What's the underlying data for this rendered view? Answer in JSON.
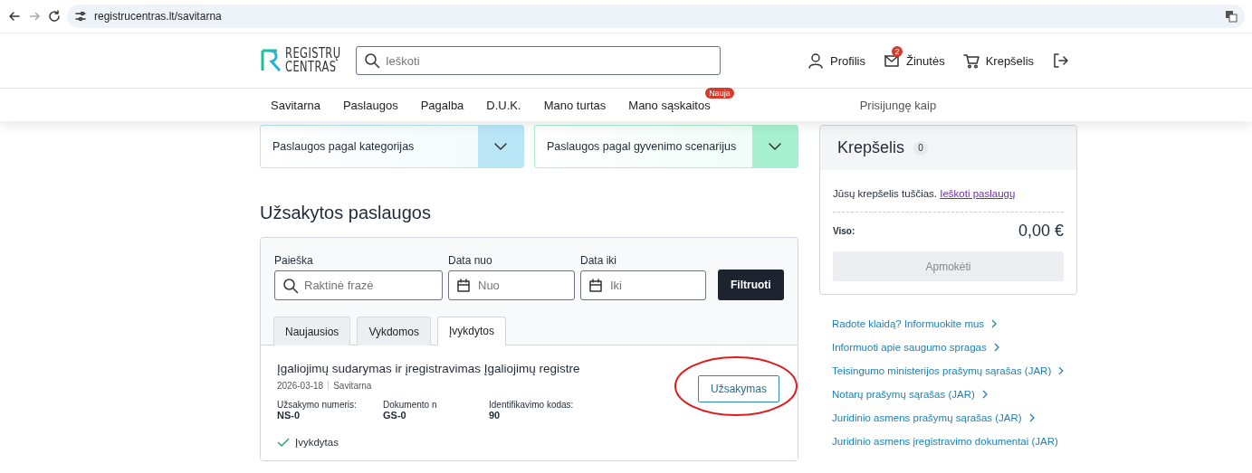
{
  "browser": {
    "url": "registrucentras.lt/savitarna"
  },
  "header": {
    "logo": {
      "line1": "REGISTRŲ",
      "line2": "CENTRAS"
    },
    "search": {
      "placeholder": "Ieškoti"
    },
    "actions": [
      {
        "kind": "profile",
        "label": "Profilis"
      },
      {
        "kind": "messages",
        "label": "Žinutės",
        "badge": "2"
      },
      {
        "kind": "cart",
        "label": "Krepšelis"
      },
      {
        "kind": "logout"
      }
    ]
  },
  "nav": {
    "items": [
      {
        "label": "Savitarna"
      },
      {
        "label": "Paslaugos"
      },
      {
        "label": "Pagalba"
      },
      {
        "label": "D.U.K."
      },
      {
        "label": "Mano turtas"
      },
      {
        "label": "Mano sąskaitos",
        "badge": "Nauja"
      }
    ],
    "logged_in": "Prisijungę kaip"
  },
  "category_dropdowns": [
    {
      "label": "Paslaugos pagal kategorijas",
      "color": "#b9e6f7"
    },
    {
      "label": "Paslaugos pagal gyvenimo scenarijus",
      "color": "#a6efd0"
    }
  ],
  "orders": {
    "title": "Užsakytos paslaugos",
    "filters": [
      {
        "kind": "search",
        "label": "Paieška",
        "placeholder": "Raktinė frazė"
      },
      {
        "kind": "date",
        "label": "Data nuo",
        "placeholder": "Nuo"
      },
      {
        "kind": "date",
        "label": "Data iki",
        "placeholder": "Iki"
      }
    ],
    "filter_button": "Filtruoti",
    "tabs": [
      {
        "label": "Naujausios",
        "selected": false
      },
      {
        "label": "Vykdomos",
        "selected": false
      },
      {
        "label": "Įvykdytos",
        "selected": true
      }
    ],
    "items": [
      {
        "title": "Įgaliojimų sudarymas ir įregistravimas Įgaliojimų registre",
        "date": "2026-03-18",
        "source": "Savitarna",
        "fields": [
          {
            "label": "Užsakymo numeris:",
            "value": "NS-0"
          },
          {
            "label": "Dokumento n",
            "value": "GS-0"
          },
          {
            "label": "Identifikavimo kodas:",
            "value": "90"
          }
        ],
        "button": "Užsakymas",
        "highlighted": true,
        "status": "Įvykdytas"
      }
    ]
  },
  "cart": {
    "title": "Krepšelis",
    "count": "0",
    "empty_text": "Jūsų krepšelis tuščias.",
    "search_link": "Ieškoti paslaugų",
    "total_label": "Viso:",
    "total": "0,00 €",
    "pay_button": "Apmokėti",
    "pay_disabled": true
  },
  "links": [
    "Radote klaidą? Informuokite mus",
    "Informuoti apie saugumo spragas",
    "Teisingumo ministerijos prašymų sąrašas (JAR)",
    "Notarų prašymų sąrašas (JAR)",
    "Juridinio asmens prašymų sąrašas (JAR)",
    "Juridinio asmens įregistravimo dokumentai (JAR)"
  ]
}
